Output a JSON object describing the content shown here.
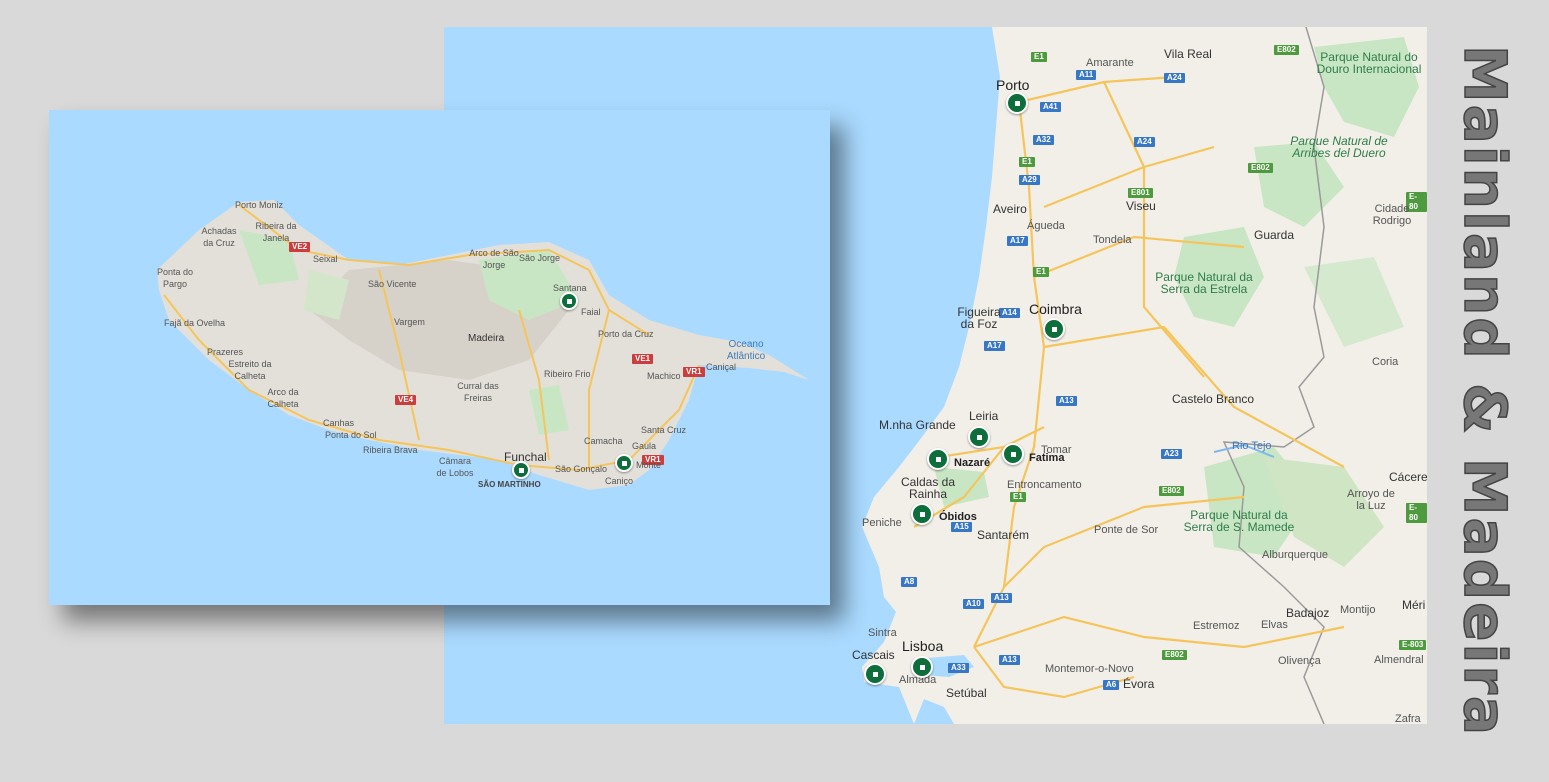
{
  "title": "Mainland & Madeira",
  "colors": {
    "pin": "#0d6e3c",
    "water": "#aadaff",
    "land": "#f2efe9",
    "park": "#c9e6c4"
  },
  "mainland": {
    "cities": [
      {
        "key": "vilareal",
        "label": "Vila Real",
        "style": "city"
      },
      {
        "key": "amarante",
        "label": "Amarante",
        "style": ""
      },
      {
        "key": "porto",
        "label": "Porto",
        "style": "big"
      },
      {
        "key": "aveiro",
        "label": "Aveiro",
        "style": "city"
      },
      {
        "key": "agueda",
        "label": "Águeda",
        "style": ""
      },
      {
        "key": "viseu",
        "label": "Viseu",
        "style": "city"
      },
      {
        "key": "tondela",
        "label": "Tondela",
        "style": ""
      },
      {
        "key": "guarda",
        "label": "Guarda",
        "style": "city"
      },
      {
        "key": "cidade",
        "label": "Cidade Rodrigo",
        "style": ""
      },
      {
        "key": "figueira",
        "label": "Figueira da Foz",
        "style": "city"
      },
      {
        "key": "coimbra",
        "label": "Coimbra",
        "style": "big"
      },
      {
        "key": "coria",
        "label": "Coria",
        "style": ""
      },
      {
        "key": "castelo",
        "label": "Castelo Branco",
        "style": "city"
      },
      {
        "key": "marinha",
        "label": "M.nha Grande",
        "style": "city"
      },
      {
        "key": "leiria",
        "label": "Leiria",
        "style": "city"
      },
      {
        "key": "tomar",
        "label": "Tomar",
        "style": ""
      },
      {
        "key": "nazare",
        "label": "Nazaré",
        "style": "bold"
      },
      {
        "key": "fatima",
        "label": "Fatima",
        "style": "bold"
      },
      {
        "key": "entron",
        "label": "Entroncamento",
        "style": ""
      },
      {
        "key": "caldas",
        "label": "Caldas da Rainha",
        "style": "city"
      },
      {
        "key": "obidos",
        "label": "Óbidos",
        "style": "bold"
      },
      {
        "key": "peniche",
        "label": "Peniche",
        "style": ""
      },
      {
        "key": "pontesor",
        "label": "Ponte de Sor",
        "style": ""
      },
      {
        "key": "santarem",
        "label": "Santarém",
        "style": "city"
      },
      {
        "key": "alburq",
        "label": "Alburquerque",
        "style": ""
      },
      {
        "key": "caceres",
        "label": "Cácere",
        "style": "city"
      },
      {
        "key": "arroyo",
        "label": "Arroyo de la Luz",
        "style": ""
      },
      {
        "key": "badajoz",
        "label": "Badajoz",
        "style": "city"
      },
      {
        "key": "montijo",
        "label": "Montijo",
        "style": ""
      },
      {
        "key": "merida",
        "label": "Méri",
        "style": "city"
      },
      {
        "key": "sintra",
        "label": "Sintra",
        "style": ""
      },
      {
        "key": "lisboa",
        "label": "Lisboa",
        "style": "big"
      },
      {
        "key": "cascais",
        "label": "Cascais",
        "style": "city"
      },
      {
        "key": "almada",
        "label": "Almada",
        "style": ""
      },
      {
        "key": "setubal",
        "label": "Setúbal",
        "style": "city"
      },
      {
        "key": "montemor",
        "label": "Montemor-o-Novo",
        "style": ""
      },
      {
        "key": "evora",
        "label": "Évora",
        "style": "city"
      },
      {
        "key": "estremoz",
        "label": "Estremoz",
        "style": ""
      },
      {
        "key": "elvas",
        "label": "Elvas",
        "style": ""
      },
      {
        "key": "olivenca",
        "label": "Olivença",
        "style": ""
      },
      {
        "key": "almendral",
        "label": "Almendral",
        "style": ""
      },
      {
        "key": "zafra",
        "label": "Zafra",
        "style": ""
      }
    ],
    "parks": [
      {
        "key": "douro",
        "label": "Parque Natural do Douro Internacional",
        "style": "park"
      },
      {
        "key": "arribes",
        "label": "Parque Natural de Arribes del Duero",
        "style": "parkit"
      },
      {
        "key": "estrela",
        "label": "Parque Natural da Serra da Estrela",
        "style": "park"
      },
      {
        "key": "mamede",
        "label": "Parque Natural da Serra de S. Mamede",
        "style": "park"
      }
    ],
    "river": "Rio Tejo",
    "roads": [
      "E1",
      "E802",
      "A11",
      "A24",
      "A41",
      "A32",
      "A24",
      "E1",
      "A29",
      "E801",
      "E802",
      "E-80",
      "A17",
      "E1",
      "A14",
      "A17",
      "A13",
      "A23",
      "E802",
      "E1",
      "A15",
      "A8",
      "A10",
      "A13",
      "A33",
      "A13",
      "E802",
      "A6",
      "E-803",
      "E-80"
    ]
  },
  "madeira": {
    "places": [
      {
        "key": "portomoniz",
        "label": "Porto Moniz",
        "style": ""
      },
      {
        "key": "achadas",
        "label": "Achadas da Cruz",
        "style": ""
      },
      {
        "key": "ribeira",
        "label": "Ribeira da Janela",
        "style": ""
      },
      {
        "key": "seixal",
        "label": "Seixal",
        "style": ""
      },
      {
        "key": "pontapargo",
        "label": "Ponta do Pargo",
        "style": ""
      },
      {
        "key": "arco",
        "label": "Arco de São Jorge",
        "style": ""
      },
      {
        "key": "saojorge",
        "label": "São Jorge",
        "style": ""
      },
      {
        "key": "saovicente",
        "label": "São Vicente",
        "style": ""
      },
      {
        "key": "santana",
        "label": "Santana",
        "style": ""
      },
      {
        "key": "faial",
        "label": "Faial",
        "style": ""
      },
      {
        "key": "fajadaovelha",
        "label": "Fajã da Ovelha",
        "style": ""
      },
      {
        "key": "vargem",
        "label": "Vargem",
        "style": ""
      },
      {
        "key": "portocruz",
        "label": "Porto da Cruz",
        "style": ""
      },
      {
        "key": "madeira",
        "label": "Madeira",
        "style": "city"
      },
      {
        "key": "prazeres",
        "label": "Prazeres",
        "style": ""
      },
      {
        "key": "estreito",
        "label": "Estreito da Calheta",
        "style": ""
      },
      {
        "key": "machico",
        "label": "Machico",
        "style": ""
      },
      {
        "key": "canical",
        "label": "Caniçal",
        "style": ""
      },
      {
        "key": "ribeirofrio",
        "label": "Ribeiro Frio",
        "style": ""
      },
      {
        "key": "curral",
        "label": "Curral das Freiras",
        "style": ""
      },
      {
        "key": "arcocalheta",
        "label": "Arco da Calheta",
        "style": ""
      },
      {
        "key": "santacruz",
        "label": "Santa Cruz",
        "style": ""
      },
      {
        "key": "canhas",
        "label": "Canhas",
        "style": ""
      },
      {
        "key": "pontasol",
        "label": "Ponta do Sol",
        "style": ""
      },
      {
        "key": "camacha",
        "label": "Camacha",
        "style": ""
      },
      {
        "key": "gaula",
        "label": "Gaula",
        "style": ""
      },
      {
        "key": "ribeirabrava",
        "label": "Ribeira Brava",
        "style": ""
      },
      {
        "key": "funchal",
        "label": "Funchal",
        "style": "city"
      },
      {
        "key": "monte",
        "label": "Monte",
        "style": ""
      },
      {
        "key": "camara",
        "label": "Câmara de Lobos",
        "style": ""
      },
      {
        "key": "saogoncalo",
        "label": "São Gonçalo",
        "style": ""
      },
      {
        "key": "canico",
        "label": "Caniço",
        "style": ""
      },
      {
        "key": "saomartinho",
        "label": "SÃO MARTINHO",
        "style": "small"
      }
    ],
    "ocean": "Oceano Atlântico",
    "roads": [
      "VE2",
      "VE1",
      "VR1",
      "VE4",
      "VR1"
    ]
  }
}
